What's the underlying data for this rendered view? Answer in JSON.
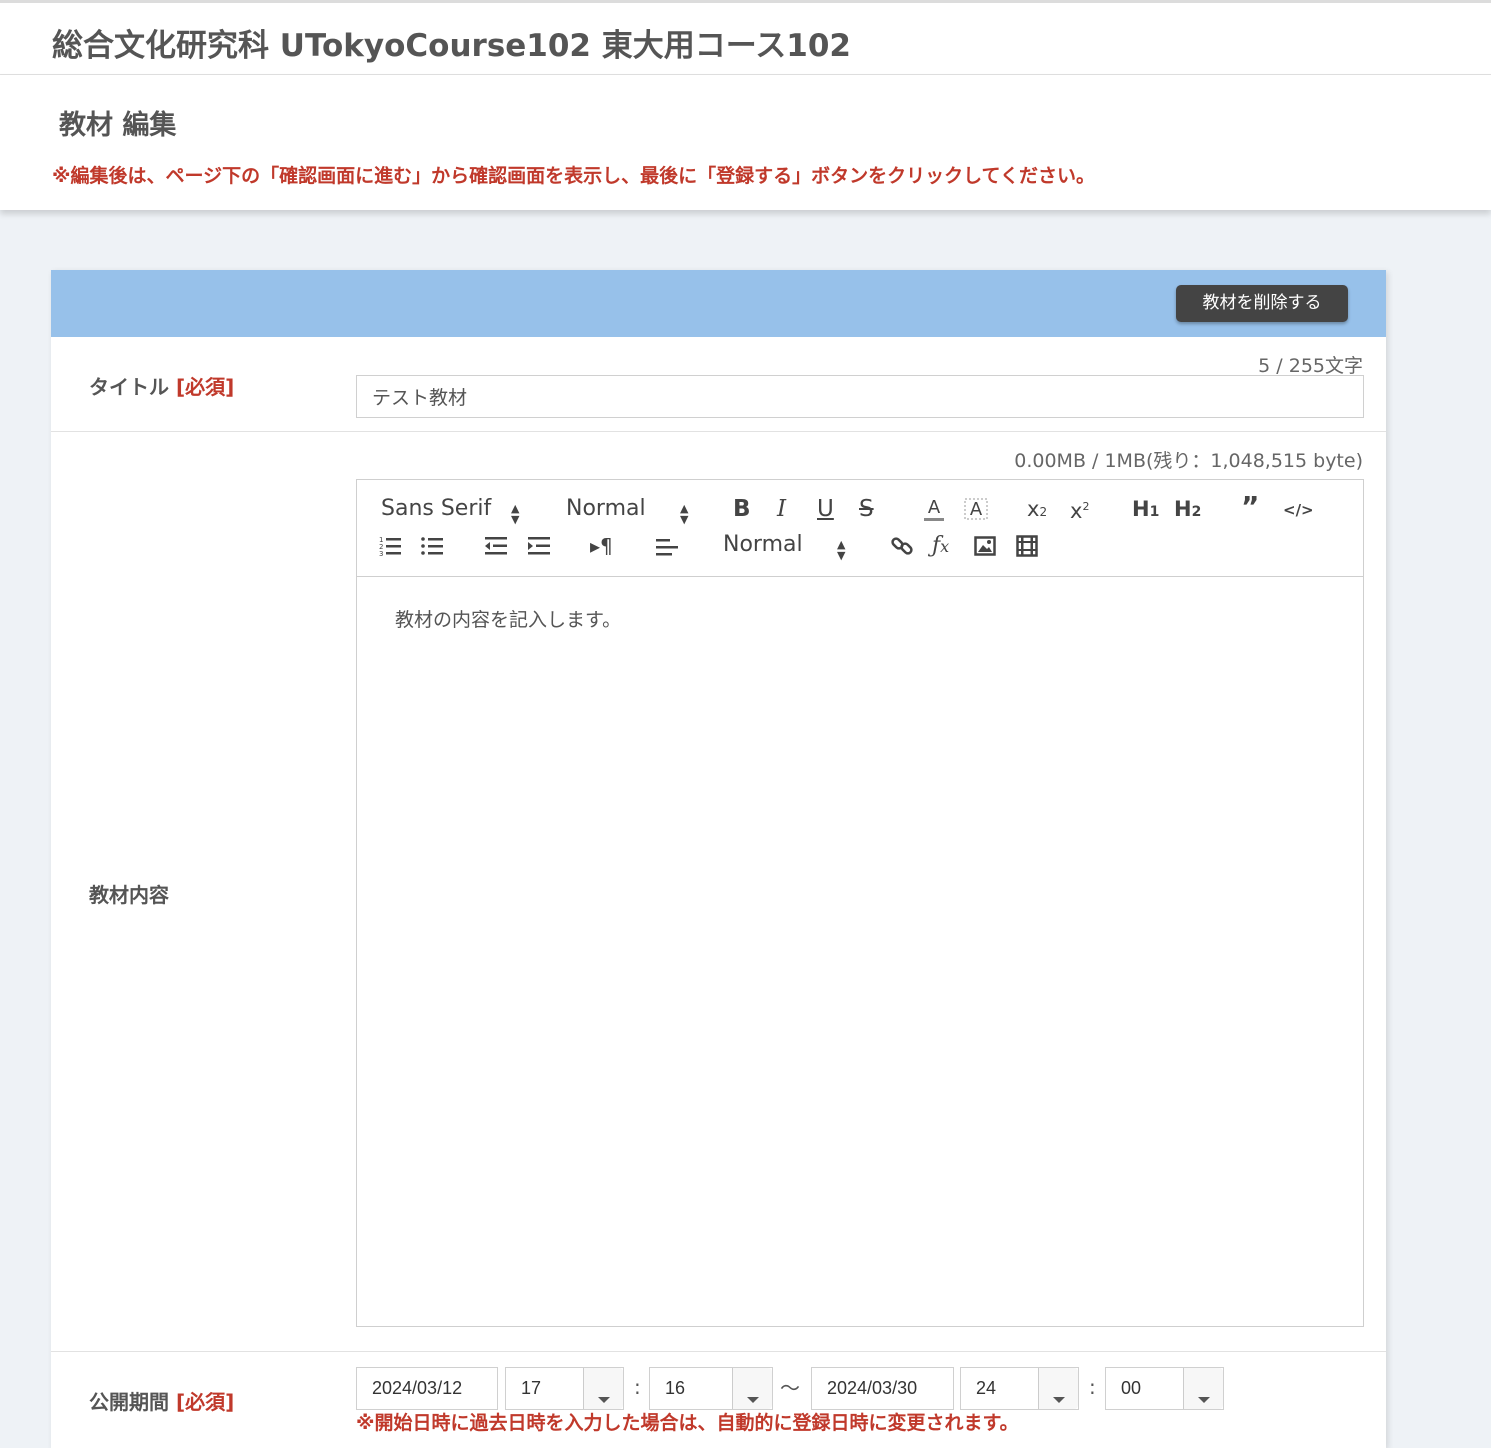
{
  "course": {
    "title": "総合文化研究科 UTokyoCourse102 東大用コース102"
  },
  "page": {
    "title": "教材 編集",
    "note": "※編集後は、ページ下の「確認画面に進む」から確認画面を表示し、最後に「登録する」ボタンをクリックしてください。"
  },
  "panel": {
    "delete_label": "教材を削除する"
  },
  "title_field": {
    "label": "タイトル",
    "required": "[必須]",
    "counter": "5 / 255文字",
    "value": "テスト教材"
  },
  "content_field": {
    "label": "教材内容",
    "size_counter": "0.00MB / 1MB(残り：1,048,515 byte)",
    "body": "教材の内容を記入します。"
  },
  "toolbar": {
    "font": "Sans Serif",
    "size": "Normal",
    "line_height": "Normal",
    "icons": [
      "bold-icon",
      "italic-icon",
      "underline-icon",
      "strike-icon",
      "font-color-icon",
      "background-color-icon",
      "subscript-icon",
      "superscript-icon",
      "h1-icon",
      "h2-icon",
      "blockquote-icon",
      "code-icon",
      "ordered-list-icon",
      "bullet-list-icon",
      "outdent-icon",
      "indent-icon",
      "text-direction-icon",
      "align-icon",
      "link-icon",
      "formula-icon",
      "image-icon",
      "video-icon"
    ]
  },
  "period_field": {
    "label": "公開期間",
    "required": "[必須]",
    "start_date": "2024/03/12",
    "start_hour": "17",
    "start_minute": "16",
    "tilde": "〜",
    "end_date": "2024/03/30",
    "end_hour": "24",
    "end_minute": "00",
    "colon": ":",
    "note": "※開始日時に過去日時を入力した場合は、自動的に登録日時に変更されます。"
  }
}
